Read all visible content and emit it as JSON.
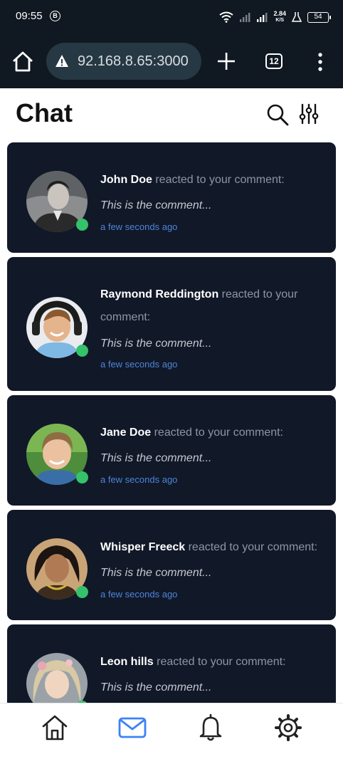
{
  "status_bar": {
    "time": "09:55",
    "b_badge": "B",
    "net_speed_value": "2.84",
    "net_speed_unit": "K/S",
    "battery": "54"
  },
  "browser": {
    "url": "92.168.8.65:3000",
    "tab_count": "12"
  },
  "page": {
    "title": "Chat"
  },
  "notifications": [
    {
      "name": "John Doe",
      "action": " reacted to your comment:",
      "comment": "This is the comment...",
      "time": "a few seconds ago"
    },
    {
      "name": "Raymond Reddington",
      "action": " reacted to your comment:",
      "comment": "This is the comment...",
      "time": "a few seconds ago"
    },
    {
      "name": "Jane Doe",
      "action": " reacted to your comment:",
      "comment": "This is the comment...",
      "time": "a few seconds ago"
    },
    {
      "name": "Whisper Freeck",
      "action": " reacted to your comment:",
      "comment": "This is the comment...",
      "time": "a few seconds ago"
    },
    {
      "name": "Leon hills",
      "action": " reacted to your comment:",
      "comment": "This is the comment..."
    }
  ],
  "bottom_nav": [
    "home-icon",
    "mail-icon",
    "bell-icon",
    "settings-icon"
  ],
  "colors": {
    "card_bg": "#111828",
    "online": "#34c26b",
    "active_nav": "#3b82f6",
    "time_link": "#4c86d8"
  }
}
